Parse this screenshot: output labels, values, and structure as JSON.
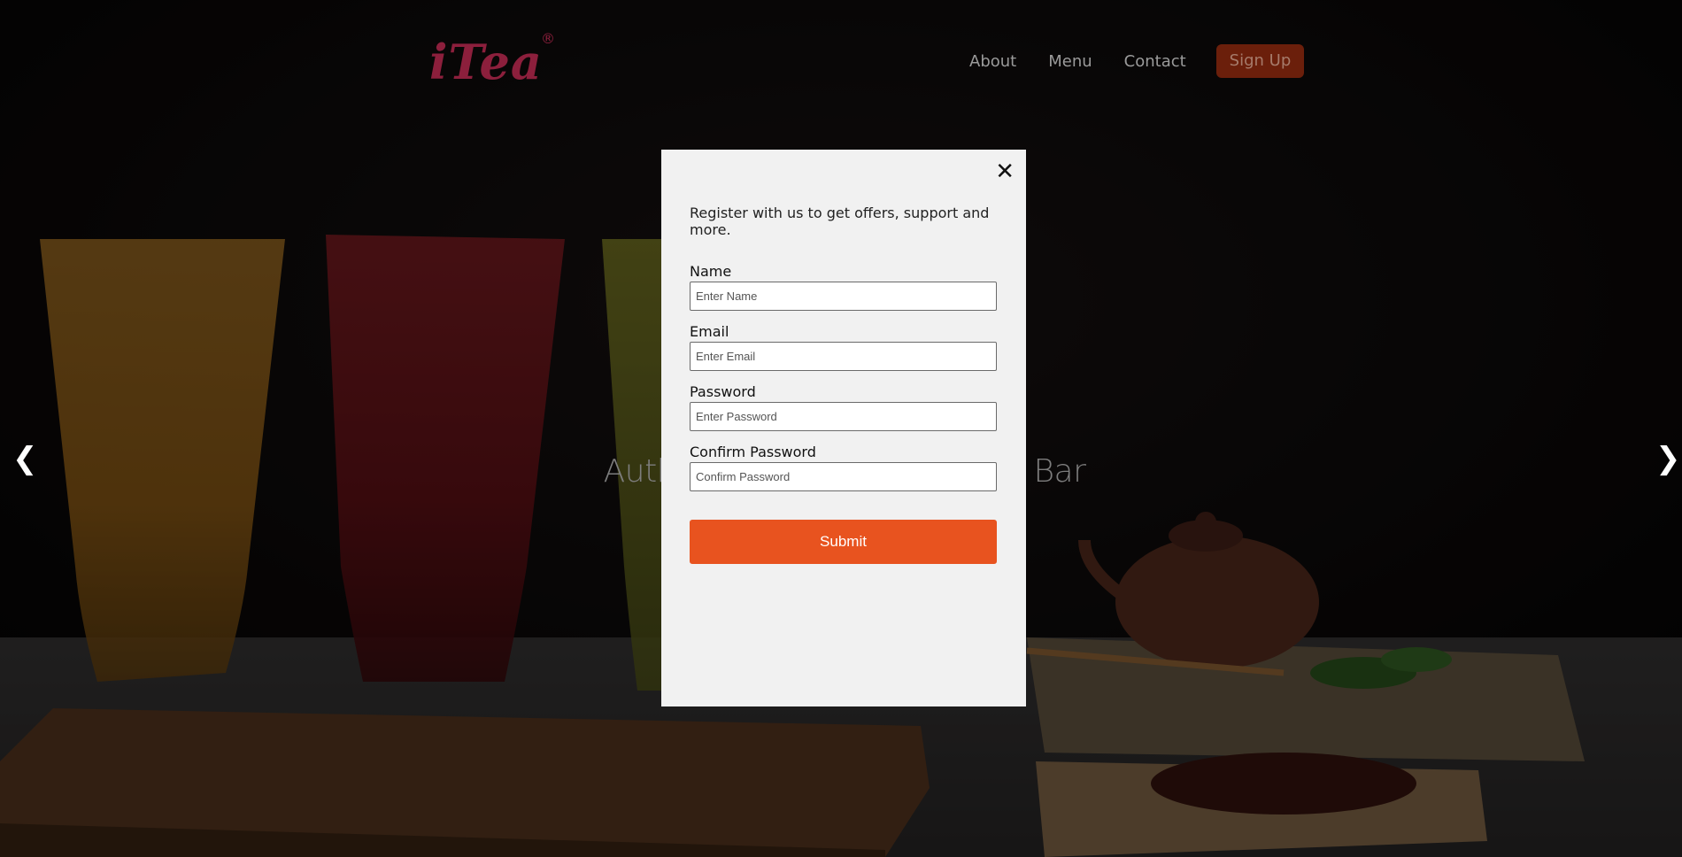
{
  "brand": {
    "wordmark": "iTea",
    "registered_mark": "®",
    "accent": "#8c1f3c"
  },
  "nav": {
    "items": [
      {
        "label": "About"
      },
      {
        "label": "Menu"
      },
      {
        "label": "Contact"
      }
    ],
    "signup_label": "Sign Up"
  },
  "hero": {
    "tagline": "Authentic Tea & Fresh Juice Bar",
    "prev_glyph": "❮",
    "next_glyph": "❯"
  },
  "modal": {
    "close_glyph": "✕",
    "intro": "Register with us to get offers, support and more.",
    "fields": [
      {
        "label": "Name",
        "placeholder": "Enter Name"
      },
      {
        "label": "Email",
        "placeholder": "Enter Email"
      },
      {
        "label": "Password",
        "placeholder": "Enter Password"
      },
      {
        "label": "Confirm Password",
        "placeholder": "Confirm Password"
      }
    ],
    "submit_label": "Submit",
    "submit_color": "#e8531f"
  }
}
